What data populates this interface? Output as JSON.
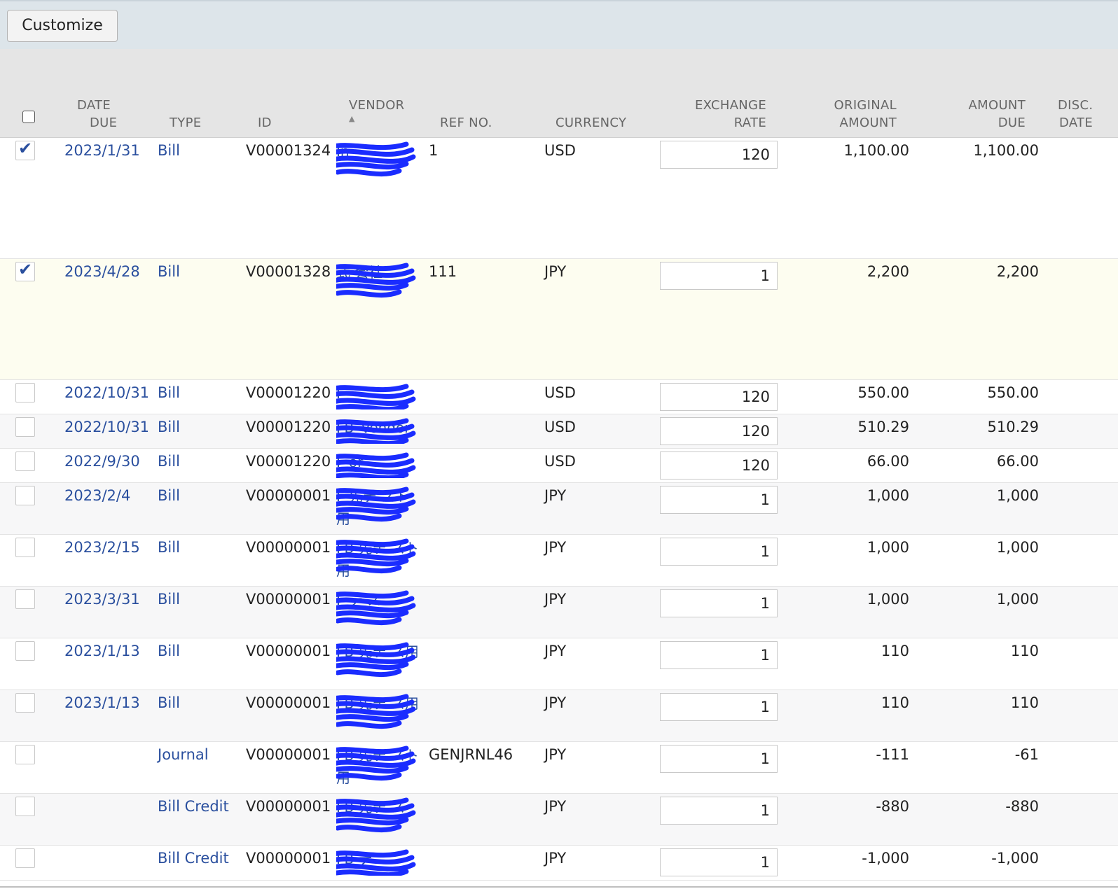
{
  "toolbar": {
    "customize_label": "Customize"
  },
  "columns": {
    "date_due_1": "DATE",
    "date_due_2": "DUE",
    "type": "TYPE",
    "id": "ID",
    "vendor": "VENDOR",
    "sort_indicator": "▲",
    "ref_no": "REF NO.",
    "currency": "CURRENCY",
    "exchange_rate_1": "EXCHANGE",
    "exchange_rate_2": "RATE",
    "original_amount_1": "ORIGINAL",
    "original_amount_2": "AMOUNT",
    "amount_due_1": "AMOUNT",
    "amount_due_2": "DUE",
    "disc_date_1": "DISC.",
    "disc_date_2": "DATE"
  },
  "rows": [
    {
      "checked": true,
      "date": "2023/1/31",
      "type": "Bill",
      "id": "V00001324",
      "vendor": "In",
      "ref": "1",
      "currency": "USD",
      "rate": "120",
      "original": "1,100.00",
      "due": "1,100.00"
    },
    {
      "checked": true,
      "date": "2023/4/28",
      "type": "Bill",
      "id": "V00001328",
      "vendor": "式 会社",
      "ref": "111",
      "currency": "JPY",
      "rate": "1",
      "original": "2,200",
      "due": "2,200"
    },
    {
      "checked": false,
      "date": "2022/10/31",
      "type": "Bill",
      "id": "V00001220",
      "vendor": "F",
      "ref": "",
      "currency": "USD",
      "rate": "120",
      "original": "550.00",
      "due": "550.00"
    },
    {
      "checked": false,
      "date": "2022/10/31",
      "type": "Bill",
      "id": "V00001220",
      "vendor": "FB_Vendor",
      "ref": "",
      "currency": "USD",
      "rate": "120",
      "original": "510.29",
      "due": "510.29"
    },
    {
      "checked": false,
      "date": "2022/9/30",
      "type": "Bill",
      "id": "V00001220",
      "vendor": "F or",
      "ref": "",
      "currency": "USD",
      "rate": "120",
      "original": "66.00",
      "due": "66.00"
    },
    {
      "checked": false,
      "date": "2023/2/4",
      "type": "Bill",
      "id": "V00000001",
      "vendor": "F 先テ スト用",
      "ref": "",
      "currency": "JPY",
      "rate": "1",
      "original": "1,000",
      "due": "1,000"
    },
    {
      "checked": false,
      "date": "2023/2/15",
      "type": "Bill",
      "id": "V00000001",
      "vendor": "FB 先テ スト用",
      "ref": "",
      "currency": "JPY",
      "rate": "1",
      "original": "1,000",
      "due": "1,000"
    },
    {
      "checked": false,
      "date": "2023/3/31",
      "type": "Bill",
      "id": "V00000001",
      "vendor": "F テ ス",
      "ref": "",
      "currency": "JPY",
      "rate": "1",
      "original": "1,000",
      "due": "1,000"
    },
    {
      "checked": false,
      "date": "2023/1/13",
      "type": "Bill",
      "id": "V00000001",
      "vendor": "FB 先テ ス用",
      "ref": "",
      "currency": "JPY",
      "rate": "1",
      "original": "110",
      "due": "110"
    },
    {
      "checked": false,
      "date": "2023/1/13",
      "type": "Bill",
      "id": "V00000001",
      "vendor": "FB 先テ ス用",
      "ref": "",
      "currency": "JPY",
      "rate": "1",
      "original": "110",
      "due": "110"
    },
    {
      "checked": false,
      "date": "",
      "type": "Journal",
      "id": "V00000001",
      "vendor": "FB 先テ スト用",
      "ref": "GENJRNL46",
      "currency": "JPY",
      "rate": "1",
      "original": "-111",
      "due": "-61"
    },
    {
      "checked": false,
      "date": "",
      "type": "Bill Credit",
      "id": "V00000001",
      "vendor": "FB 先テ ス",
      "ref": "",
      "currency": "JPY",
      "rate": "1",
      "original": "-880",
      "due": "-880"
    },
    {
      "checked": false,
      "date": "",
      "type": "Bill Credit",
      "id": "V00000001",
      "vendor": "FB テ",
      "ref": "",
      "currency": "JPY",
      "rate": "1",
      "original": "-1,000",
      "due": "-1,000"
    }
  ],
  "colors": {
    "link": "#2a4f9e",
    "redaction": "#1a2cff",
    "highlight_row": "#fdfdf0",
    "header_bg": "#e5e5e5",
    "toolbar_bg": "#dde5ea"
  }
}
